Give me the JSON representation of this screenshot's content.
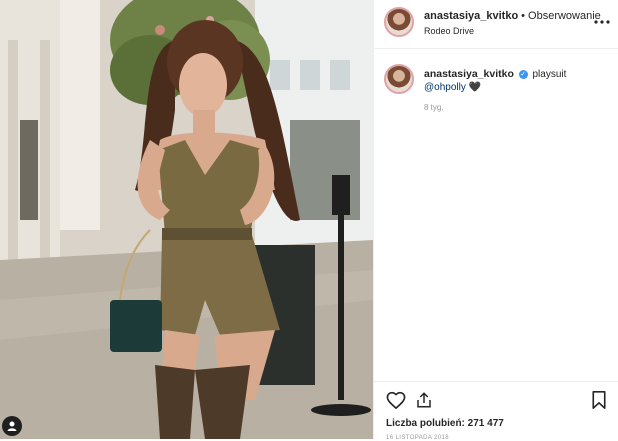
{
  "post": {
    "photo_alt": "photo",
    "header": {
      "username": "anastasiya_kvitko",
      "separator": "•",
      "follow_label": "Obserwowanie",
      "location": "Rodeo Drive",
      "more_icon": "more-horizontal-icon"
    },
    "caption": {
      "username": "anastasiya_kvitko",
      "text": "playsuit",
      "mention": "@ohpolly",
      "emoji": "🖤",
      "time": "8 tyg."
    },
    "actions": {
      "like_icon": "heart-icon",
      "share_icon": "share-icon",
      "save_icon": "bookmark-icon",
      "likes_text": "Liczba polubień: 271 477",
      "date": "16 LISTOPADA 2018"
    }
  },
  "colors": {
    "verified": "#3897f0",
    "mention": "#003569",
    "border": "#efefef",
    "muted": "#999999"
  }
}
